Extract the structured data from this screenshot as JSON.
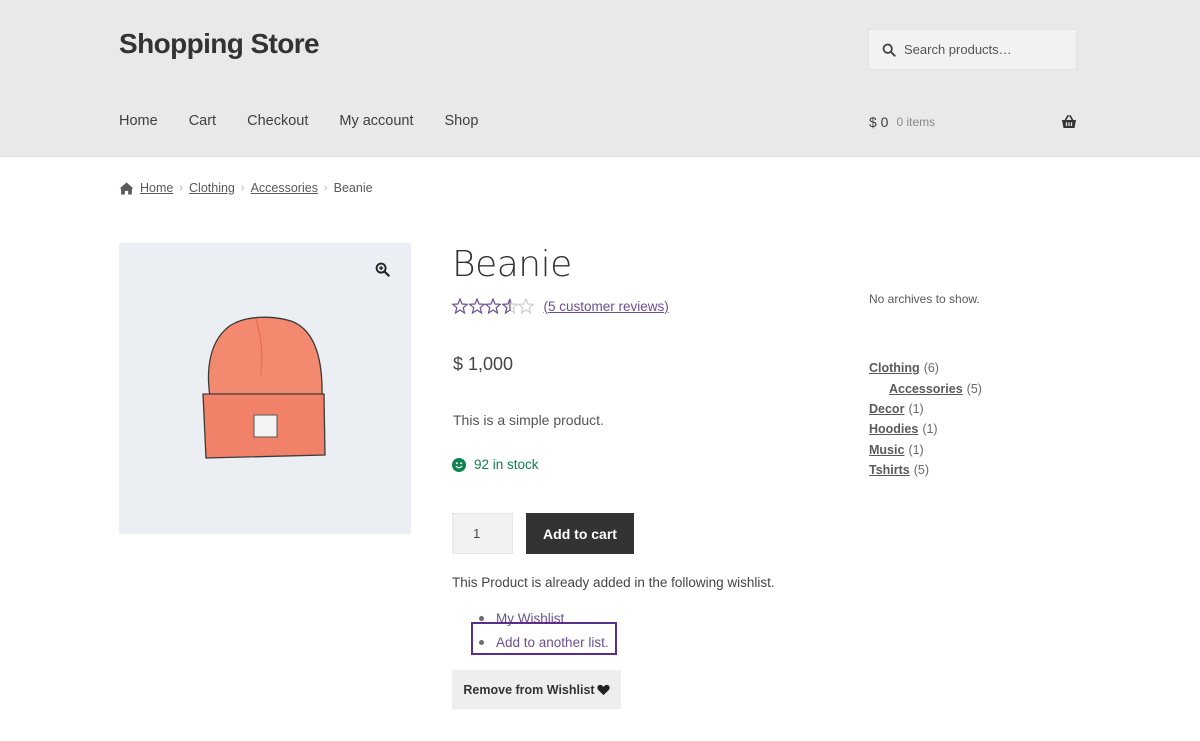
{
  "header": {
    "site_title": "Shopping Store",
    "search_placeholder": "Search products…",
    "nav": [
      "Home",
      "Cart",
      "Checkout",
      "My account",
      "Shop"
    ],
    "cart_amount": "$ 0",
    "cart_items": "0 items"
  },
  "breadcrumb": {
    "items": [
      "Home",
      "Clothing",
      "Accessories"
    ],
    "current": "Beanie"
  },
  "product": {
    "title": "Beanie",
    "rating": 3.5,
    "rating_max": 5,
    "reviews_text": "(5 customer reviews)",
    "price": "$ 1,000",
    "description": "This is a simple product.",
    "stock": "92 in stock",
    "quantity": "1",
    "add_to_cart_label": "Add to cart"
  },
  "wishlist": {
    "note": "This Product is already added in the following wishlist.",
    "items": [
      "My Wishlist",
      "Add to another list."
    ],
    "remove_label": "Remove from Wishlist"
  },
  "sidebar": {
    "no_archives": "No archives to show.",
    "categories": [
      {
        "name": "Clothing",
        "count": "(6)",
        "child": false
      },
      {
        "name": "Accessories",
        "count": "(5)",
        "child": true
      },
      {
        "name": "Decor",
        "count": "(1)",
        "child": false
      },
      {
        "name": "Hoodies",
        "count": "(1)",
        "child": false
      },
      {
        "name": "Music",
        "count": "(1)",
        "child": false
      },
      {
        "name": "Tshirts",
        "count": "(5)",
        "child": false
      }
    ]
  },
  "colors": {
    "header_bg": "#e9e9e9",
    "accent_purple": "#6c4f92",
    "stock_green": "#0f834d",
    "button_dark": "#333333",
    "beanie_color": "#f2826d"
  }
}
